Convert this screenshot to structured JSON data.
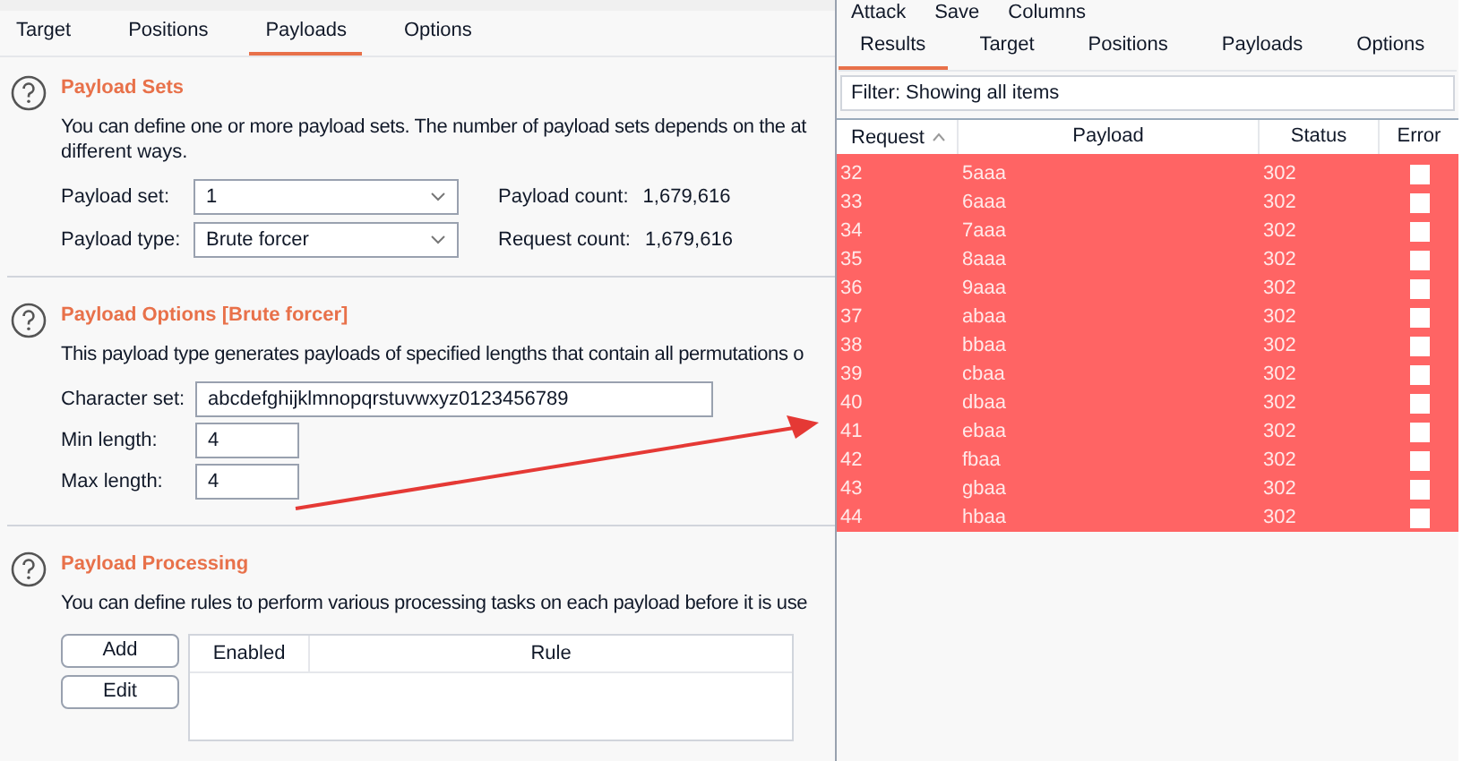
{
  "left_tabs": [
    {
      "label": "Target",
      "selected": false
    },
    {
      "label": "Positions",
      "selected": false
    },
    {
      "label": "Payloads",
      "selected": true
    },
    {
      "label": "Options",
      "selected": false
    }
  ],
  "payload_sets": {
    "title": "Payload Sets",
    "description": "You can define one or more payload sets. The number of payload sets depends on the at",
    "description_2": "different ways.",
    "set_label": "Payload set:",
    "set_value": "1",
    "type_label": "Payload type:",
    "type_value": "Brute forcer",
    "payload_count_label": "Payload count:",
    "payload_count": "1,679,616",
    "request_count_label": "Request count:",
    "request_count": "1,679,616"
  },
  "payload_options": {
    "title": "Payload Options [Brute forcer]",
    "description": "This payload type generates payloads of specified lengths that contain all permutations o",
    "fields": [
      {
        "label": "Character set:",
        "value": "abcdefghijklmnopqrstuvwxyz0123456789",
        "kind": "wide"
      },
      {
        "label": "Min length:",
        "value": "4",
        "kind": "short"
      },
      {
        "label": "Max length:",
        "value": "4",
        "kind": "short"
      }
    ]
  },
  "payload_processing": {
    "title": "Payload Processing",
    "description": "You can define rules to perform various processing tasks on each payload before it is use",
    "buttons": [
      "Add",
      "Edit"
    ],
    "columns": [
      "Enabled",
      "Rule"
    ]
  },
  "results_window": {
    "menu": [
      "Attack",
      "Save",
      "Columns"
    ],
    "tabs": [
      {
        "label": "Results",
        "selected": true
      },
      {
        "label": "Target",
        "selected": false
      },
      {
        "label": "Positions",
        "selected": false
      },
      {
        "label": "Payloads",
        "selected": false
      },
      {
        "label": "Options",
        "selected": false
      }
    ],
    "filter": "Filter: Showing all items",
    "columns": [
      "Request",
      "Payload",
      "Status",
      "Error"
    ],
    "rows": [
      {
        "request": "32",
        "payload": "5aaa",
        "status": "302",
        "error": false
      },
      {
        "request": "33",
        "payload": "6aaa",
        "status": "302",
        "error": false
      },
      {
        "request": "34",
        "payload": "7aaa",
        "status": "302",
        "error": false
      },
      {
        "request": "35",
        "payload": "8aaa",
        "status": "302",
        "error": false
      },
      {
        "request": "36",
        "payload": "9aaa",
        "status": "302",
        "error": false
      },
      {
        "request": "37",
        "payload": "abaa",
        "status": "302",
        "error": false
      },
      {
        "request": "38",
        "payload": "bbaa",
        "status": "302",
        "error": false
      },
      {
        "request": "39",
        "payload": "cbaa",
        "status": "302",
        "error": false
      },
      {
        "request": "40",
        "payload": "dbaa",
        "status": "302",
        "error": false
      },
      {
        "request": "41",
        "payload": "ebaa",
        "status": "302",
        "error": false
      },
      {
        "request": "42",
        "payload": "fbaa",
        "status": "302",
        "error": false
      },
      {
        "request": "43",
        "payload": "gbaa",
        "status": "302",
        "error": false
      },
      {
        "request": "44",
        "payload": "hbaa",
        "status": "302",
        "error": false
      }
    ]
  }
}
